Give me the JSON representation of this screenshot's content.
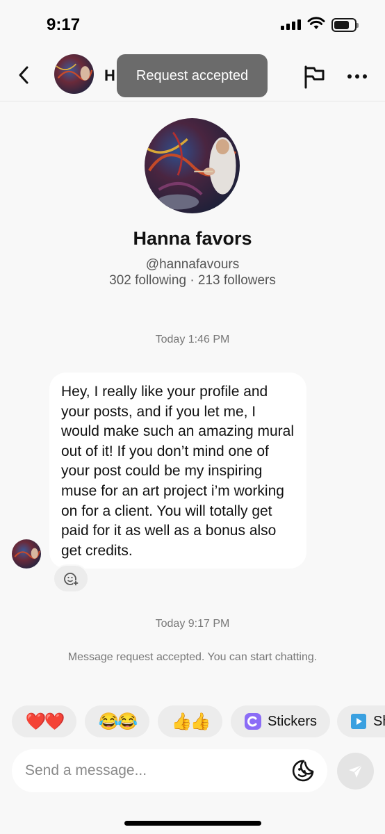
{
  "status_bar": {
    "time": "9:17",
    "battery_level": 0.75,
    "icons": [
      "signal-icon",
      "wifi-icon",
      "battery-icon"
    ]
  },
  "header": {
    "name_initial": "H",
    "toast": "Request accepted",
    "icons": [
      "back-icon",
      "flag-icon",
      "more-icon"
    ]
  },
  "profile": {
    "name": "Hanna favors",
    "handle": "@hannafavours",
    "stats": "302 following · 213 followers"
  },
  "conversation": {
    "timestamp_1": "Today 1:46 PM",
    "message": "Hey, I really like your profile and your posts, and if you let me, I would make such an amazing mural out of it! If you don’t mind one of your post could be my inspiring muse for an art project i’m working on for a client. You will totally get paid for it as well as a bonus  also get credits.",
    "timestamp_2": "Today 9:17 PM",
    "system_message": "Message request accepted. You can start chatting."
  },
  "quick_replies": {
    "chip_1": "❤️❤️",
    "chip_2": "😂😂",
    "chip_3": "👍👍",
    "stickers_label": "Stickers",
    "share_label": "Sh"
  },
  "composer": {
    "placeholder": "Send a message..."
  },
  "colors": {
    "background": "#f8f8f8",
    "bubble": "#ffffff",
    "chip": "#ececec",
    "toast": "#6b6b6b",
    "stickers_icon": "#8b6cf6",
    "share_icon": "#3aa0e0"
  }
}
